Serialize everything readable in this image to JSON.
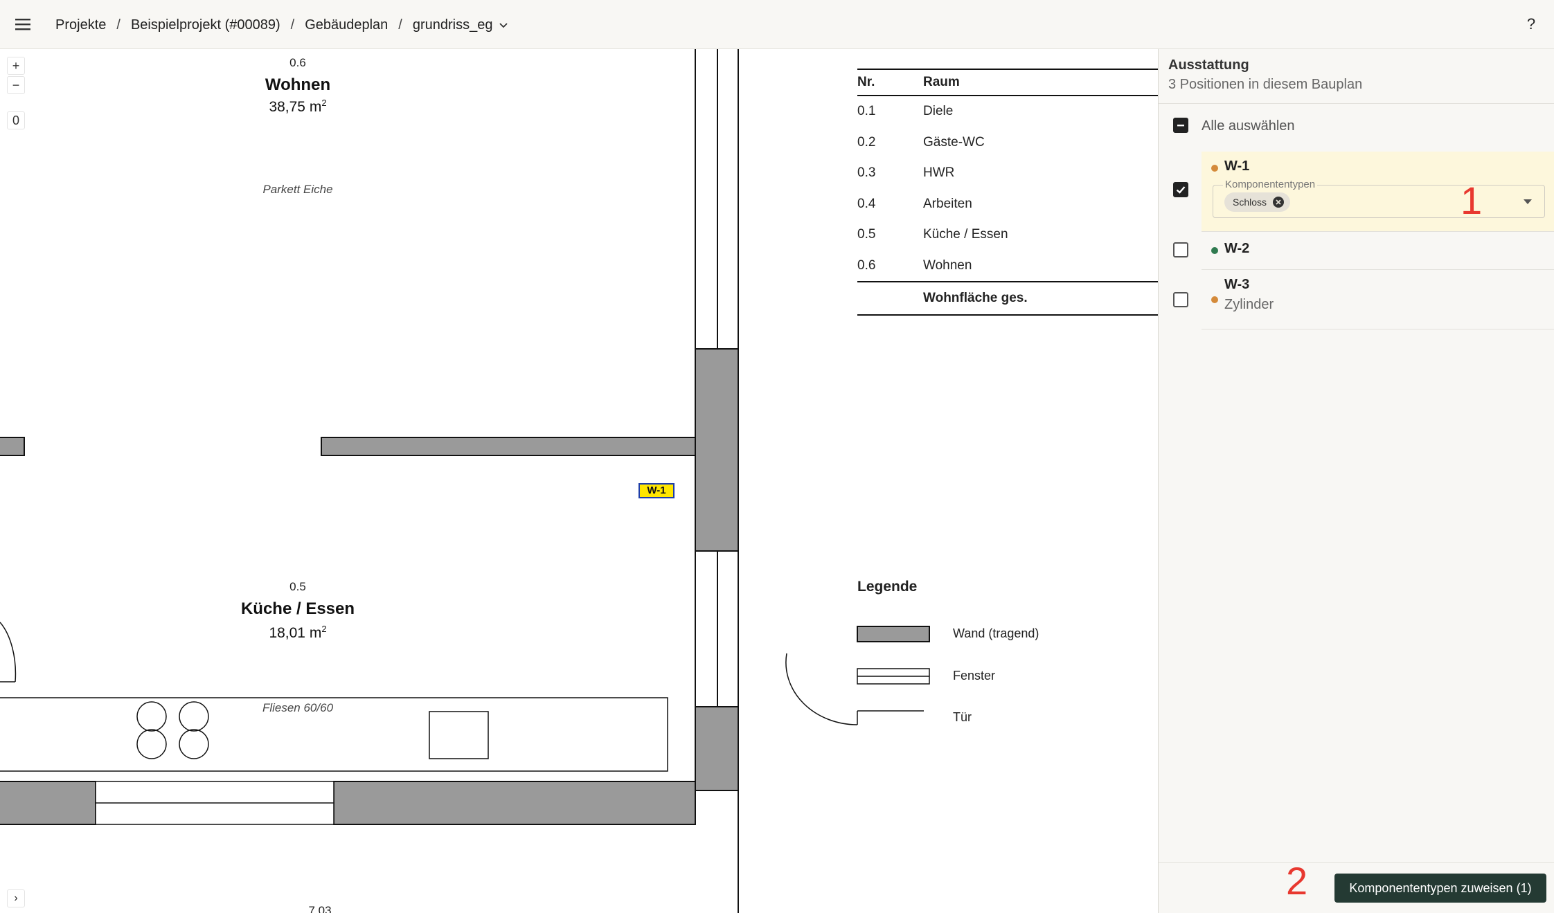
{
  "header": {
    "breadcrumbs": [
      "Projekte",
      "Beispielprojekt (#00089)",
      "Gebäudeplan",
      "grundriss_eg"
    ],
    "separator": "/",
    "help_label": "?"
  },
  "plan": {
    "zoom_in": "+",
    "zoom_out": "−",
    "zoom_reset": "0",
    "expand": "›",
    "rooms": [
      {
        "no": "0.6",
        "name": "Wohnen",
        "area": "38,75 m",
        "area_unit_sup": "2",
        "floor": "Parkett Eiche"
      },
      {
        "no": "0.5",
        "name": "Küche / Essen",
        "area": "18,01 m",
        "area_unit_sup": "2",
        "floor": "Fliesen 60/60"
      }
    ],
    "bottom_dimension": "7,03",
    "marker": "W-1",
    "room_table": {
      "headers": [
        "Nr.",
        "Raum"
      ],
      "rows": [
        {
          "nr": "0.1",
          "raum": "Diele"
        },
        {
          "nr": "0.2",
          "raum": "Gäste-WC"
        },
        {
          "nr": "0.3",
          "raum": "HWR"
        },
        {
          "nr": "0.4",
          "raum": "Arbeiten"
        },
        {
          "nr": "0.5",
          "raum": "Küche / Essen"
        },
        {
          "nr": "0.6",
          "raum": "Wohnen"
        }
      ],
      "total_label": "Wohnfläche ges."
    },
    "legend": {
      "title": "Legende",
      "items": [
        "Wand (tragend)",
        "Fenster",
        "Tür"
      ]
    }
  },
  "panel": {
    "title": "Ausstattung",
    "subtitle": "3 Positionen in diesem Bauplan",
    "select_all_label": "Alle auswählen",
    "items": [
      {
        "label": "W-1",
        "dot_color": "#d48a3a",
        "checked": true,
        "field_label": "Komponententypen",
        "chips": [
          "Schloss"
        ]
      },
      {
        "label": "W-2",
        "dot_color": "#2f7a4f",
        "checked": false
      },
      {
        "label": "W-3",
        "dot_color": "#d48a3a",
        "checked": false,
        "sub": "Zylinder"
      }
    ],
    "annotations": [
      "1",
      "2"
    ],
    "assign_button": "Komponententypen zuweisen (1)"
  },
  "colors": {
    "wall": "#9a9a9a",
    "marker_bg": "#ffe600",
    "marker_border": "#1f3ea8",
    "primary_button": "#243a33",
    "annotation": "#e8382f",
    "highlight": "#fdf7dc"
  }
}
